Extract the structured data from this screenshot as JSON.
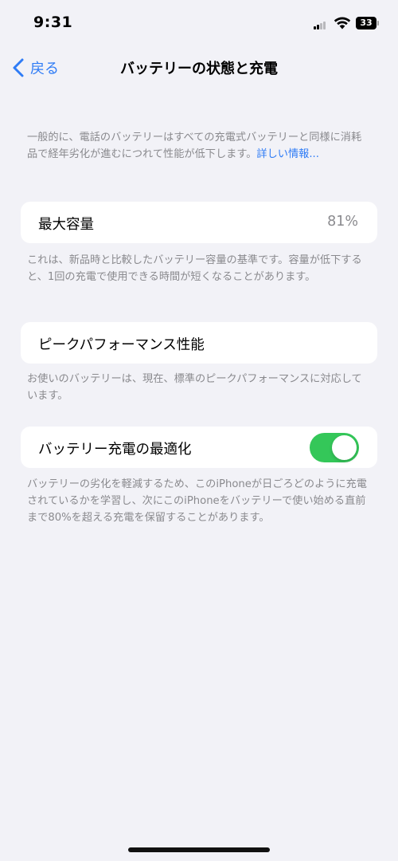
{
  "status_bar": {
    "time": "9:31",
    "battery_level": "33",
    "icons": [
      "cellular-signal-icon",
      "wifi-icon",
      "battery-icon"
    ]
  },
  "nav": {
    "back_label": "戻る",
    "title": "バッテリーの状態と充電"
  },
  "intro": {
    "text": "一般的に、電話のバッテリーはすべての充電式バッテリーと同様に消耗品で経年劣化が進むにつれて性能が低下します。",
    "link": "詳しい情報..."
  },
  "max_capacity": {
    "label": "最大容量",
    "value": "81%",
    "note": "これは、新品時と比較したバッテリー容量の基準です。容量が低下すると、1回の充電で使用できる時間が短くなることがあります。"
  },
  "peak_performance": {
    "label": "ピークパフォーマンス性能",
    "note": "お使いのバッテリーは、現在、標準のピークパフォーマンスに対応しています。"
  },
  "optimized_charging": {
    "label": "バッテリー充電の最適化",
    "enabled": true,
    "note": "バッテリーの劣化を軽減するため、このiPhoneが日ごろどのように充電されているかを学習し、次にこのiPhoneをバッテリーで使い始める直前まで80%を超える充電を保留することがあります。"
  },
  "colors": {
    "background": "#f2f2f7",
    "accent": "#2f7cf6",
    "toggle_on": "#34c759",
    "secondary_text": "#8a8a8e"
  }
}
